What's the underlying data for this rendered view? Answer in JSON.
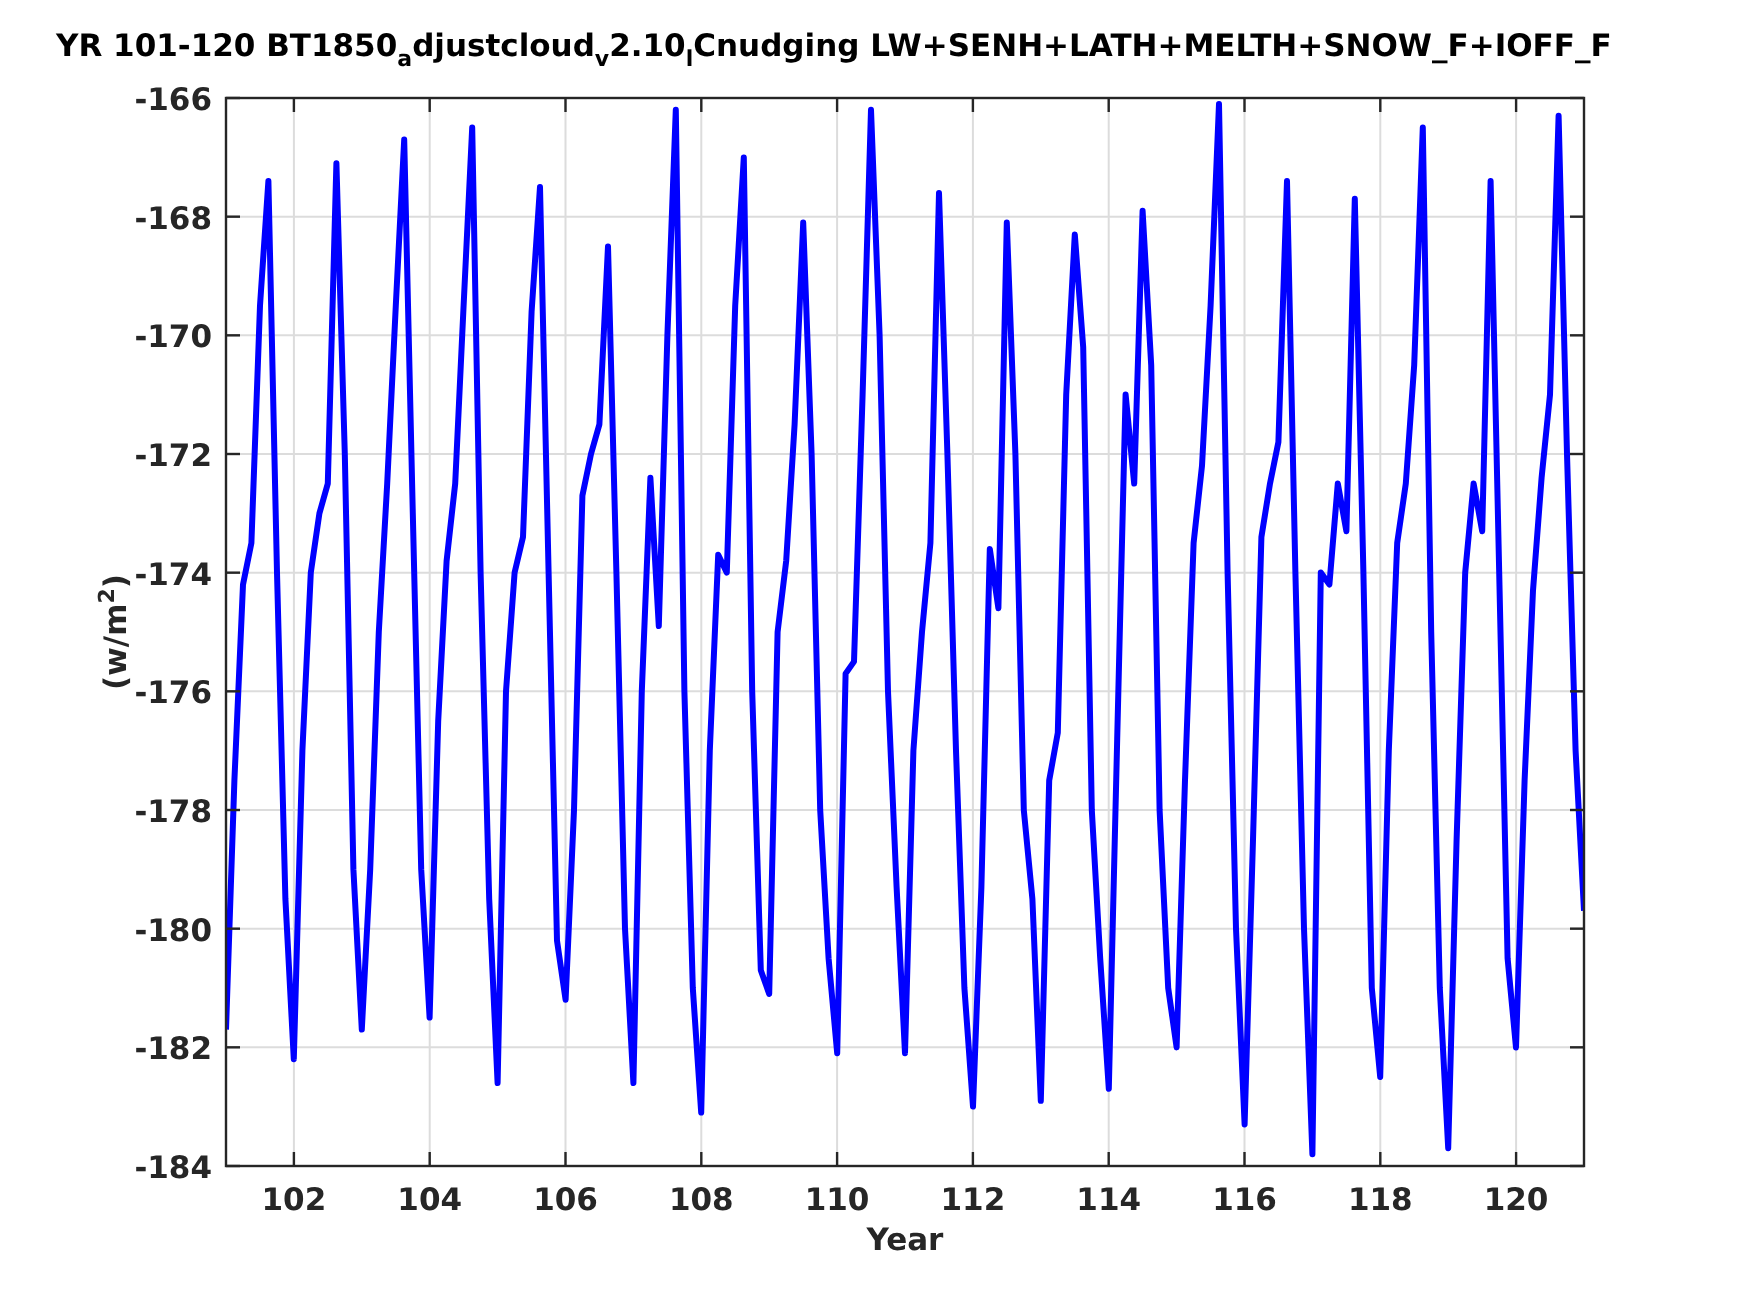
{
  "figure": {
    "chart_data": {
      "type": "line",
      "title": "YR 101-120 BT1850$_{a}$djustcloud$_{v}$2.10$_{l}$Cnudging LW+SENH+LATH+MELTH+SNOW_F+IOFF_F",
      "grid": true,
      "xlabel": "Year",
      "ylabel": "(w/m$^{2}$)",
      "xlim": [
        101,
        121
      ],
      "ylim": [
        -184,
        -166
      ],
      "xticks": [
        102,
        104,
        106,
        108,
        110,
        112,
        114,
        116,
        118,
        120
      ],
      "yticks": [
        -184,
        -182,
        -180,
        -178,
        -176,
        -174,
        -172,
        -170,
        -168,
        -166
      ],
      "x": [
        101,
        101.125,
        101.25,
        101.375,
        101.5,
        101.625,
        101.75,
        101.875,
        102,
        102.125,
        102.25,
        102.375,
        102.5,
        102.625,
        102.75,
        102.875,
        103,
        103.125,
        103.25,
        103.375,
        103.5,
        103.625,
        103.75,
        103.875,
        104,
        104.125,
        104.25,
        104.375,
        104.5,
        104.625,
        104.75,
        104.875,
        105,
        105.125,
        105.25,
        105.375,
        105.5,
        105.625,
        105.75,
        105.875,
        106,
        106.125,
        106.25,
        106.375,
        106.5,
        106.625,
        106.75,
        106.875,
        107,
        107.125,
        107.25,
        107.375,
        107.5,
        107.625,
        107.75,
        107.875,
        108,
        108.125,
        108.25,
        108.375,
        108.5,
        108.625,
        108.75,
        108.875,
        109,
        109.125,
        109.25,
        109.375,
        109.5,
        109.625,
        109.75,
        109.875,
        110,
        110.125,
        110.25,
        110.375,
        110.5,
        110.625,
        110.75,
        110.875,
        111,
        111.125,
        111.25,
        111.375,
        111.5,
        111.625,
        111.75,
        111.875,
        112,
        112.125,
        112.25,
        112.375,
        112.5,
        112.625,
        112.75,
        112.875,
        113,
        113.125,
        113.25,
        113.375,
        113.5,
        113.625,
        113.75,
        113.875,
        114,
        114.125,
        114.25,
        114.375,
        114.5,
        114.625,
        114.75,
        114.875,
        115,
        115.125,
        115.25,
        115.375,
        115.5,
        115.625,
        115.75,
        115.875,
        116,
        116.125,
        116.25,
        116.375,
        116.5,
        116.625,
        116.75,
        116.875,
        117,
        117.125,
        117.25,
        117.375,
        117.5,
        117.625,
        117.75,
        117.875,
        118,
        118.125,
        118.25,
        118.375,
        118.5,
        118.625,
        118.75,
        118.875,
        119,
        119.125,
        119.25,
        119.375,
        119.5,
        119.625,
        119.75,
        119.875,
        120,
        120.125,
        120.25,
        120.375,
        120.5,
        120.625,
        120.75,
        120.875,
        121
      ],
      "series": [
        {
          "color": "#0000ff",
          "values": [
            -181.7,
            -177.5,
            -174.2,
            -173.5,
            -169.5,
            -167.4,
            -174,
            -179.5,
            -182.2,
            -177,
            -174,
            -173,
            -172.5,
            -167.1,
            -172,
            -179,
            -181.7,
            -179,
            -175,
            -172.5,
            -169.5,
            -166.7,
            -173,
            -179,
            -181.5,
            -176.5,
            -173.8,
            -172.5,
            -169.5,
            -166.5,
            -174,
            -179.5,
            -182.6,
            -176,
            -174,
            -173.4,
            -169.6,
            -167.5,
            -174,
            -180.2,
            -181.2,
            -178,
            -172.7,
            -172,
            -171.5,
            -168.5,
            -174,
            -180,
            -182.6,
            -176,
            -172.4,
            -174.9,
            -170,
            -166.2,
            -176,
            -181,
            -183.1,
            -177,
            -173.7,
            -174,
            -169.5,
            -167,
            -176,
            -180.7,
            -181.1,
            -175,
            -173.8,
            -171.5,
            -168.1,
            -172,
            -178,
            -180.5,
            -182.1,
            -175.7,
            -175.5,
            -171,
            -166.2,
            -170,
            -176,
            -179.3,
            -182.1,
            -177,
            -175,
            -173.5,
            -167.6,
            -172,
            -177,
            -181,
            -183,
            -179.3,
            -173.6,
            -174.6,
            -168.1,
            -172,
            -178,
            -179.5,
            -182.9,
            -177.5,
            -176.7,
            -171,
            -168.3,
            -170.2,
            -178,
            -180.5,
            -182.7,
            -176.8,
            -171,
            -172.5,
            -167.9,
            -170.5,
            -178,
            -181,
            -182,
            -177.5,
            -173.5,
            -172.2,
            -169.5,
            -166.1,
            -174,
            -180,
            -183.3,
            -178.5,
            -173.4,
            -172.5,
            -171.8,
            -167.4,
            -174,
            -180,
            -183.8,
            -174,
            -174.2,
            -172.5,
            -173.3,
            -167.7,
            -174,
            -181,
            -182.5,
            -177,
            -173.5,
            -172.5,
            -170.5,
            -166.5,
            -175,
            -181,
            -183.7,
            -178.5,
            -174,
            -172.5,
            -173.3,
            -167.4,
            -174,
            -180.5,
            -182,
            -177.5,
            -174.3,
            -172.4,
            -171,
            -166.3,
            -172,
            -177,
            -179.7
          ]
        }
      ]
    }
  }
}
